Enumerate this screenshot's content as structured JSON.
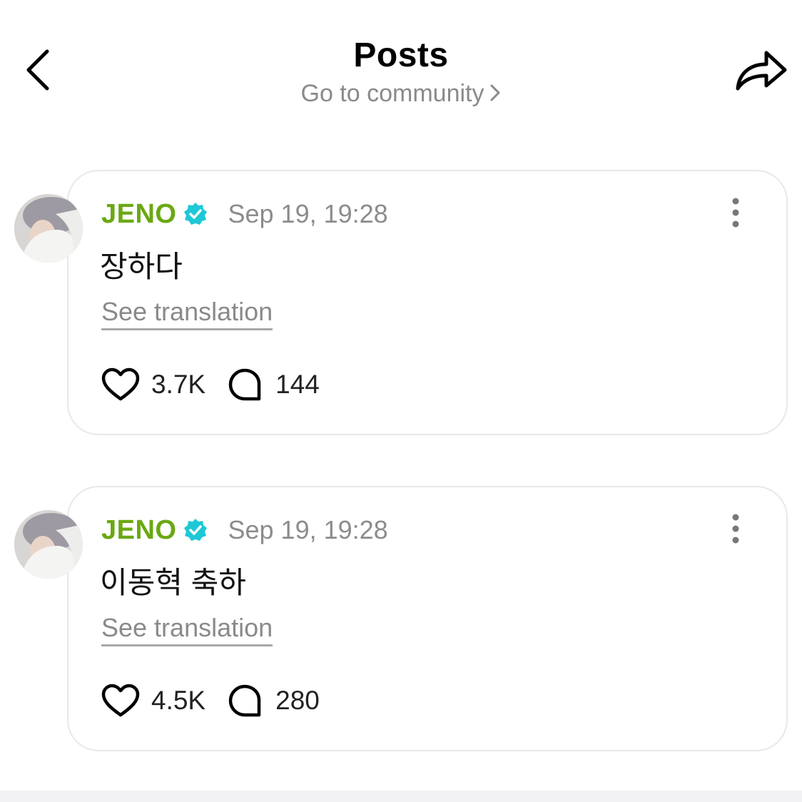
{
  "header": {
    "title": "Posts",
    "community_link": "Go to community",
    "icons": {
      "back": "chevron-left-icon",
      "share": "share-icon"
    }
  },
  "posts": [
    {
      "author": "JENO",
      "verified": true,
      "timestamp": "Sep 19, 19:28",
      "text": "장하다",
      "translate_label": "See translation",
      "likes": "3.7K",
      "comments": "144"
    },
    {
      "author": "JENO",
      "verified": true,
      "timestamp": "Sep 19, 19:28",
      "text": "이동혁 축하",
      "translate_label": "See translation",
      "likes": "4.5K",
      "comments": "280"
    }
  ],
  "colors": {
    "author_green": "#6aa812",
    "verified_teal": "#1ec8d6",
    "muted_gray": "#8a8a8a",
    "card_border": "#e8e8ea"
  }
}
